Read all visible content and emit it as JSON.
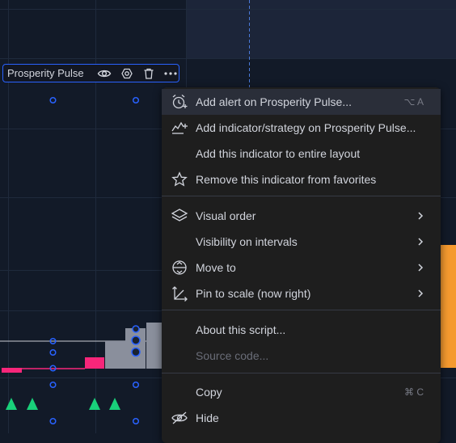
{
  "indicator": {
    "name": "Prosperity Pulse",
    "buttons": [
      {
        "id": "visibility",
        "icon": "eye-icon"
      },
      {
        "id": "settings",
        "icon": "gear-icon"
      },
      {
        "id": "delete",
        "icon": "trash-icon"
      },
      {
        "id": "more",
        "icon": "more-dots-icon"
      }
    ]
  },
  "context_menu": {
    "items": {
      "add_alert": {
        "label": "Add alert on Prosperity Pulse...",
        "shortcut": "⌥ A",
        "icon": "alarm-clock-plus-icon"
      },
      "add_indicator": {
        "label": "Add indicator/strategy on Prosperity Pulse...",
        "icon": "indicator-plus-icon"
      },
      "add_to_layout": {
        "label": "Add this indicator to entire layout"
      },
      "remove_favorite": {
        "label": "Remove this indicator from favorites",
        "icon": "star-icon"
      },
      "visual_order": {
        "label": "Visual order",
        "icon": "layers-icon",
        "submenu": true
      },
      "visibility_intervals": {
        "label": "Visibility on intervals",
        "submenu": true
      },
      "move_to": {
        "label": "Move to",
        "icon": "move-icon",
        "submenu": true
      },
      "pin_to_scale": {
        "label": "Pin to scale (now right)",
        "icon": "pin-scale-icon",
        "submenu": true
      },
      "about_script": {
        "label": "About this script..."
      },
      "source_code": {
        "label": "Source code...",
        "disabled": true
      },
      "copy": {
        "label": "Copy",
        "shortcut": "⌘ C"
      },
      "hide": {
        "label": "Hide",
        "icon": "eye-crossed-icon"
      }
    }
  },
  "colors": {
    "background": "#121a28",
    "highlight": "#1c2539",
    "grid": "#1f2a3c",
    "menu_bg": "#1e1e1e",
    "menu_hover": "#2a2e39",
    "pink": "#f7267a",
    "gray_bar": "#8a8f9c",
    "orange": "#f59a2f",
    "green": "#19d17a",
    "accent_blue": "#2962ff"
  }
}
